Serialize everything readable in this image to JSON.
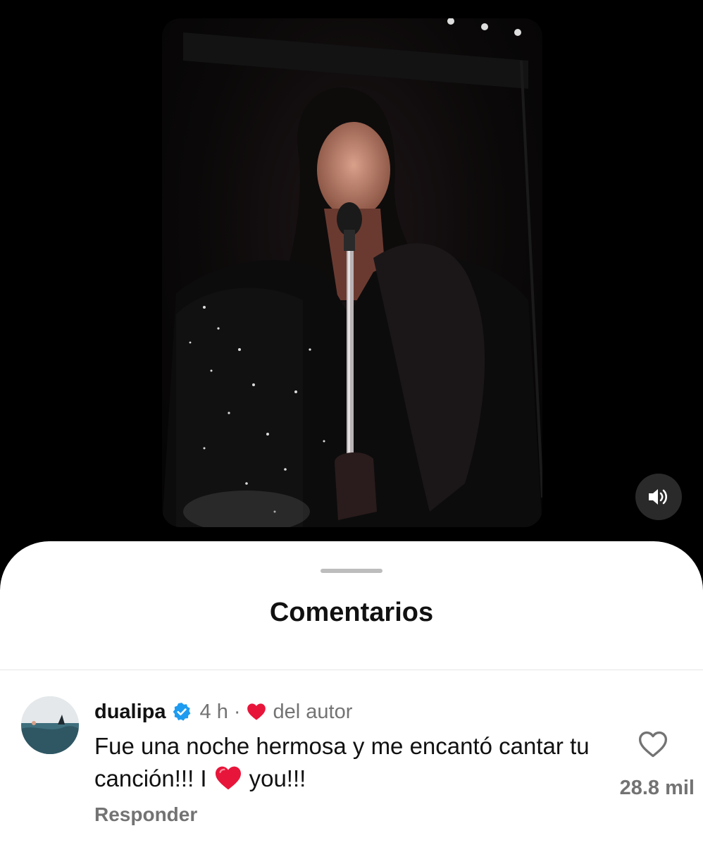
{
  "video": {
    "sound_icon": "speaker-icon"
  },
  "comments_sheet": {
    "title": "Comentarios"
  },
  "comment": {
    "username": "dualipa",
    "verified_icon": "verified-badge-icon",
    "time": "4 h",
    "separator": "·",
    "author_like_label": "del autor",
    "text_part1": "Fue una noche hermosa y me encantó cantar tu canción!!! I",
    "text_part2": "you!!!",
    "reply_label": "Responder",
    "like_count": "28.8 mil",
    "accent_color": "#1d9bf0",
    "heart_color": "#e8153a"
  }
}
